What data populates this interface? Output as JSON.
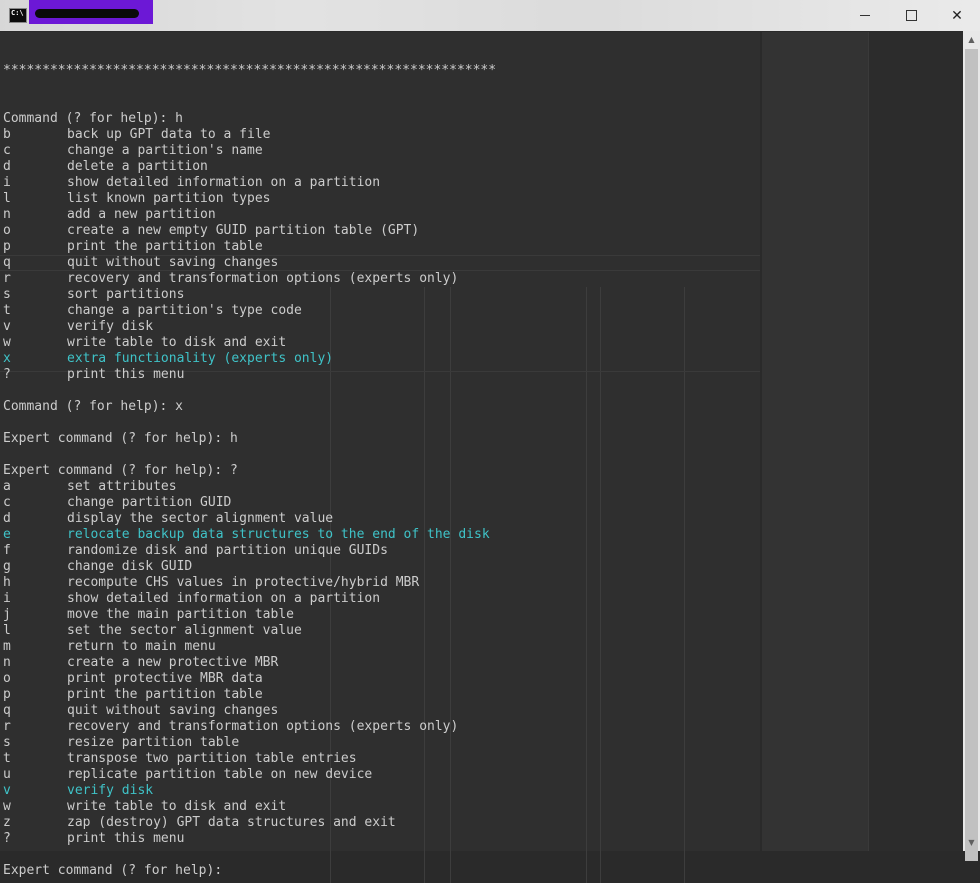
{
  "window": {
    "icon_label": "C:\\",
    "controls": {
      "minimize": "minimize",
      "maximize": "maximize",
      "close": "close"
    }
  },
  "console": {
    "separator": "***************************************************************",
    "blocks": [
      {
        "type": "blank"
      },
      {
        "type": "prompt",
        "text": "Command (? for help): h"
      },
      {
        "type": "item",
        "key": "b",
        "desc": "back up GPT data to a file"
      },
      {
        "type": "item",
        "key": "c",
        "desc": "change a partition's name"
      },
      {
        "type": "item",
        "key": "d",
        "desc": "delete a partition"
      },
      {
        "type": "item",
        "key": "i",
        "desc": "show detailed information on a partition"
      },
      {
        "type": "item",
        "key": "l",
        "desc": "list known partition types"
      },
      {
        "type": "item",
        "key": "n",
        "desc": "add a new partition"
      },
      {
        "type": "item",
        "key": "o",
        "desc": "create a new empty GUID partition table (GPT)"
      },
      {
        "type": "item",
        "key": "p",
        "desc": "print the partition table"
      },
      {
        "type": "item",
        "key": "q",
        "desc": "quit without saving changes"
      },
      {
        "type": "item",
        "key": "r",
        "desc": "recovery and transformation options (experts only)"
      },
      {
        "type": "item",
        "key": "s",
        "desc": "sort partitions"
      },
      {
        "type": "item",
        "key": "t",
        "desc": "change a partition's type code"
      },
      {
        "type": "item",
        "key": "v",
        "desc": "verify disk"
      },
      {
        "type": "item",
        "key": "w",
        "desc": "write table to disk and exit"
      },
      {
        "type": "item",
        "key": "x",
        "desc": "extra functionality (experts only)",
        "highlight": true
      },
      {
        "type": "item",
        "key": "?",
        "desc": "print this menu"
      },
      {
        "type": "blank"
      },
      {
        "type": "prompt",
        "text": "Command (? for help): x"
      },
      {
        "type": "blank"
      },
      {
        "type": "prompt",
        "text": "Expert command (? for help): h"
      },
      {
        "type": "blank"
      },
      {
        "type": "prompt",
        "text": "Expert command (? for help): ?"
      },
      {
        "type": "item",
        "key": "a",
        "desc": "set attributes"
      },
      {
        "type": "item",
        "key": "c",
        "desc": "change partition GUID"
      },
      {
        "type": "item",
        "key": "d",
        "desc": "display the sector alignment value"
      },
      {
        "type": "item",
        "key": "e",
        "desc": "relocate backup data structures to the end of the disk",
        "highlight": true
      },
      {
        "type": "item",
        "key": "f",
        "desc": "randomize disk and partition unique GUIDs"
      },
      {
        "type": "item",
        "key": "g",
        "desc": "change disk GUID"
      },
      {
        "type": "item",
        "key": "h",
        "desc": "recompute CHS values in protective/hybrid MBR"
      },
      {
        "type": "item",
        "key": "i",
        "desc": "show detailed information on a partition"
      },
      {
        "type": "item",
        "key": "j",
        "desc": "move the main partition table"
      },
      {
        "type": "item",
        "key": "l",
        "desc": "set the sector alignment value"
      },
      {
        "type": "item",
        "key": "m",
        "desc": "return to main menu"
      },
      {
        "type": "item",
        "key": "n",
        "desc": "create a new protective MBR"
      },
      {
        "type": "item",
        "key": "o",
        "desc": "print protective MBR data"
      },
      {
        "type": "item",
        "key": "p",
        "desc": "print the partition table"
      },
      {
        "type": "item",
        "key": "q",
        "desc": "quit without saving changes"
      },
      {
        "type": "item",
        "key": "r",
        "desc": "recovery and transformation options (experts only)"
      },
      {
        "type": "item",
        "key": "s",
        "desc": "resize partition table"
      },
      {
        "type": "item",
        "key": "t",
        "desc": "transpose two partition table entries"
      },
      {
        "type": "item",
        "key": "u",
        "desc": "replicate partition table on new device"
      },
      {
        "type": "item",
        "key": "v",
        "desc": "verify disk",
        "highlight": true
      },
      {
        "type": "item",
        "key": "w",
        "desc": "write table to disk and exit"
      },
      {
        "type": "item",
        "key": "z",
        "desc": "zap (destroy) GPT data structures and exit"
      },
      {
        "type": "item",
        "key": "?",
        "desc": "print this menu"
      },
      {
        "type": "blank"
      },
      {
        "type": "prompt",
        "text": "Expert command (? for help): "
      }
    ]
  },
  "colors": {
    "console_text": "#cccccc",
    "highlight_text": "#3fc3c8",
    "console_bg": "#2a2a2a",
    "title_redaction": "#6c18d6"
  }
}
